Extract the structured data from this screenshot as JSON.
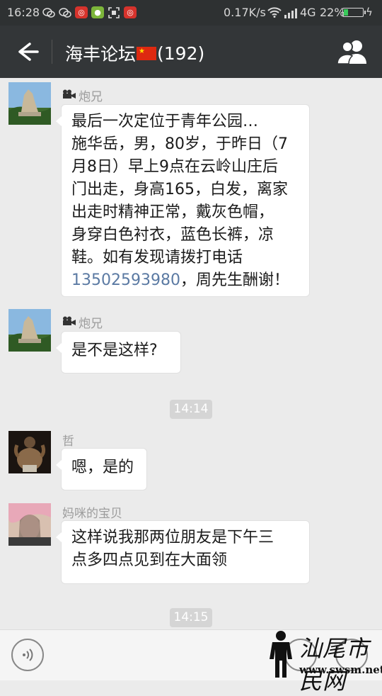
{
  "status_bar": {
    "time": "16:28",
    "speed": "0.17K/s",
    "network": "4G",
    "battery": "22%",
    "battery_level": 0.22
  },
  "header": {
    "title_name": "海丰论坛",
    "title_count": "(192)"
  },
  "messages": [
    {
      "sender": "炮兄",
      "text_lines": [
        "最后一次定位于青年公园…",
        "施华岳，男，80岁，于昨日（7",
        "月8日）早上9点在云岭山庄后",
        "门出走，身高165，白发，离家",
        "出走时精神正常，戴灰色帽，",
        "身穿白色衬衣，蓝色长裤，凉",
        "鞋。如有发现请拨打电话"
      ],
      "phone": "13502593980",
      "tail": "，周先生酬谢！"
    },
    {
      "sender": "炮兄",
      "text": "是不是这样?"
    },
    {
      "sender": "哲",
      "text": "嗯，是的"
    },
    {
      "sender": "妈咪的宝贝",
      "text_lines": [
        "这样说我那两位朋友是下午三",
        "点多四点见到在大面领"
      ]
    }
  ],
  "timestamps": [
    "14:14",
    "14:15"
  ],
  "watermark": {
    "logo": "汕尾市民网",
    "url": "www.swsm.net"
  },
  "colors": {
    "status_bar": "#2e3132",
    "title_bar": "#333638",
    "chat_bg": "#ebebeb",
    "bubble": "#ffffff",
    "phone_link": "#5b7aa3"
  }
}
